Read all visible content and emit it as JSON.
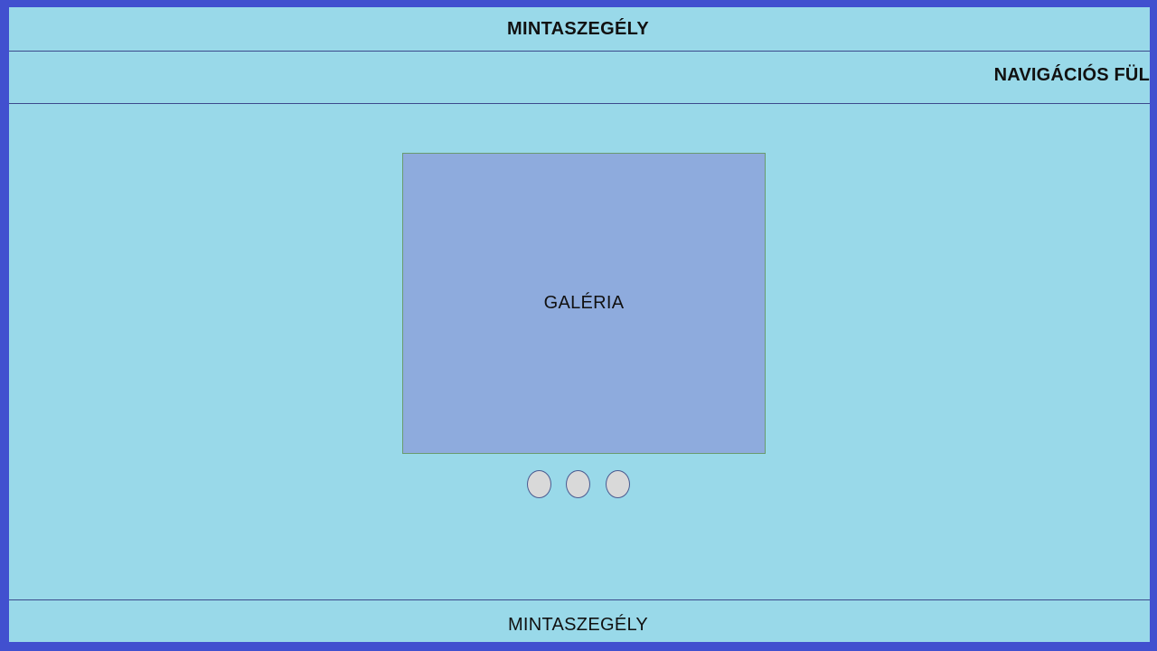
{
  "header": {
    "title": "MINTASZEGÉLY"
  },
  "nav": {
    "tab_label": "NAVIGÁCIÓS FÜL"
  },
  "gallery": {
    "label": "GALÉRIA",
    "indicator_count": 3
  },
  "footer": {
    "title": "MINTASZEGÉLY"
  },
  "colors": {
    "outer_border": "#4150cf",
    "page_background": "#99d9e9",
    "gallery_background": "#8eabdd",
    "indicator_fill": "#d9d9d9",
    "divider": "#3b4a8c"
  }
}
